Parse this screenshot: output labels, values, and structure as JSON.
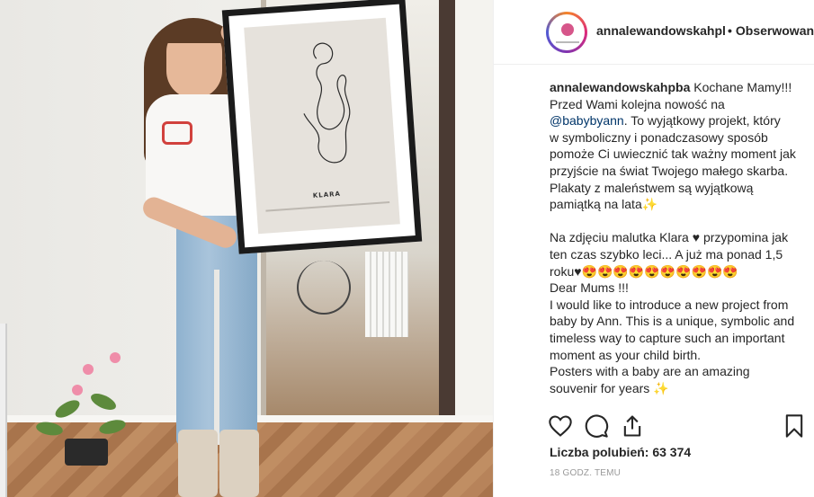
{
  "post": {
    "username": "annalewandowskahpl",
    "follow_separator": "•",
    "follow_label": "Obserwowanie",
    "caption_user": "annalewandowskahpba",
    "caption_lines": [
      " Kochane Mamy!!!",
      "Przed Wami kolejna nowość na",
      ". To wyjątkowy projekt, który",
      "w symboliczny i ponadczasowy sposób",
      "pomoże Ci uwiecznić tak ważny moment jak",
      "przyjście na świat Twojego małego skarba.",
      "Plakaty z maleństwem są wyjątkową",
      "pamiątką na lata✨",
      "",
      "Na zdjęciu malutka Klara ♥ przypomina jak",
      "ten czas szybko leci... A już ma ponad 1,5",
      "roku♥😍😍😍😍😍😍😍😍😍😍",
      "Dear Mums !!!",
      "I would like to introduce a new project from",
      "baby by Ann. This is a unique, symbolic and",
      "timeless way to capture such an important",
      "moment as your child birth.",
      "Posters with a baby are an amazing",
      "souvenir for years ✨"
    ],
    "mention": "@babybyann",
    "likes_text": "Liczba polubień: 63 374",
    "timestamp": "18 GODZ. TEMU",
    "icons": [
      "heart-icon",
      "comment-icon",
      "share-icon",
      "bookmark-icon"
    ]
  },
  "photo": {
    "poster_name": "KLARA"
  },
  "colors": {
    "text": "#262626",
    "muted": "#999999",
    "mention": "#003569",
    "border": "#efefef"
  }
}
